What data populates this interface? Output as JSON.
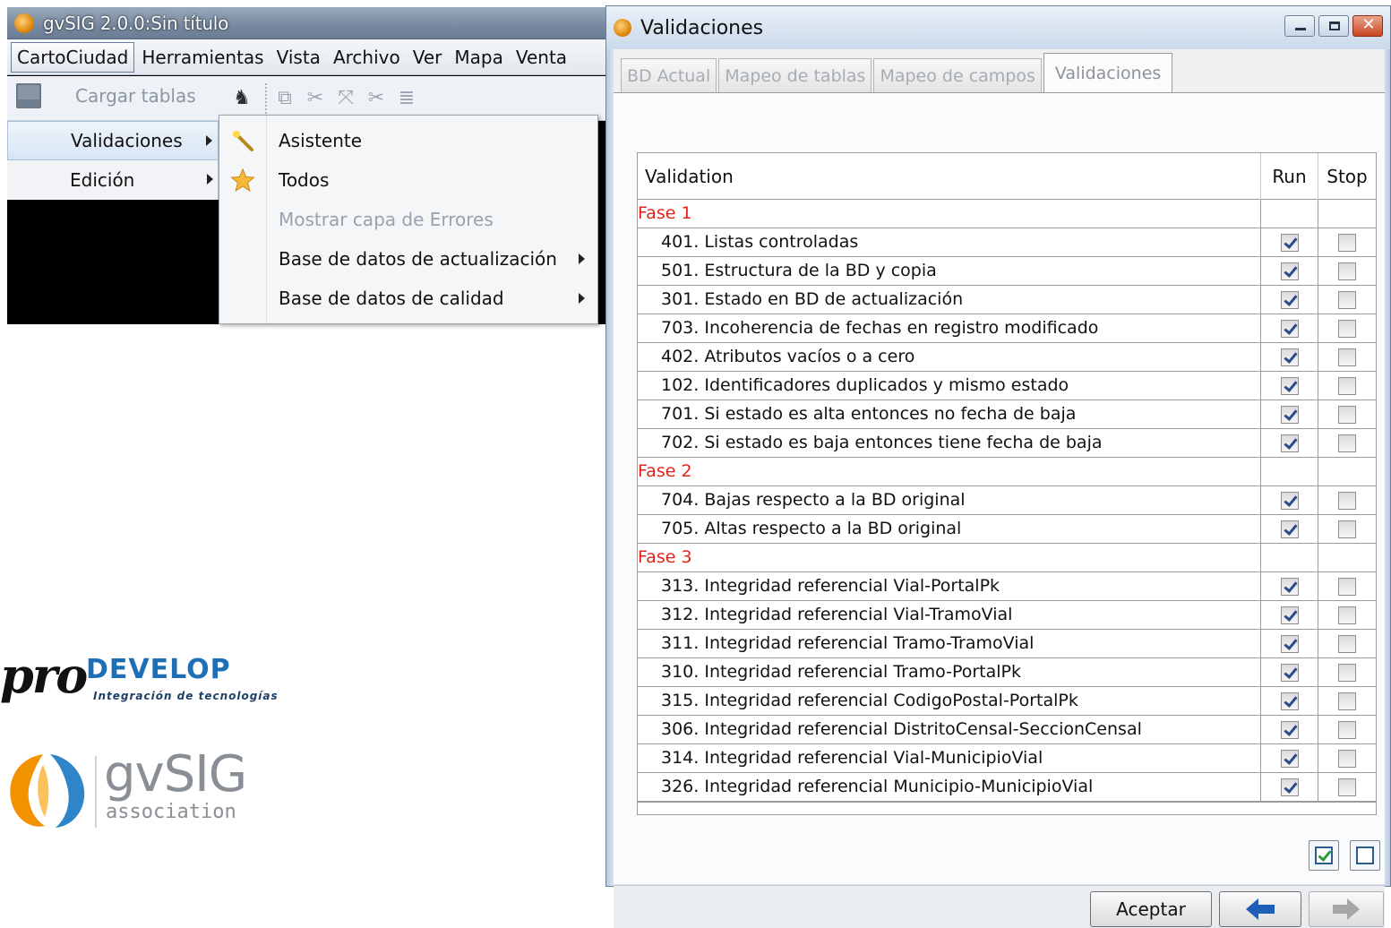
{
  "main_window": {
    "title": "gvSIG 2.0.0:Sin título",
    "menubar": [
      "CartoCiudad",
      "Herramientas",
      "Vista",
      "Archivo",
      "Ver",
      "Mapa",
      "Venta"
    ],
    "toolbar": {
      "cargar_tablas": "Cargar tablas"
    },
    "cartociudad_menu": {
      "items": [
        {
          "label": "Validaciones",
          "highlighted": true
        },
        {
          "label": "Edición",
          "highlighted": false
        }
      ]
    },
    "validaciones_submenu": {
      "items": [
        {
          "label": "Asistente",
          "icon": "wand-icon",
          "enabled": true,
          "has_submenu": false
        },
        {
          "label": "Todos",
          "icon": "star-icon",
          "enabled": true,
          "has_submenu": false
        },
        {
          "label": "Mostrar capa de Errores",
          "icon": "",
          "enabled": false,
          "has_submenu": false
        },
        {
          "label": "Base de datos de actualización",
          "icon": "",
          "enabled": true,
          "has_submenu": true
        },
        {
          "label": "Base de datos de calidad",
          "icon": "",
          "enabled": true,
          "has_submenu": true
        }
      ]
    }
  },
  "logos": {
    "prodevelop": {
      "pro": "pro",
      "develop": "DEVELOP",
      "tagline": "Integración de tecnologías"
    },
    "gvsig": {
      "name": "gvSIG",
      "sub": "association"
    }
  },
  "dialog": {
    "title": "Validaciones",
    "tabs": [
      {
        "label": "BD Actual",
        "active": false
      },
      {
        "label": "Mapeo de tablas",
        "active": false
      },
      {
        "label": "Mapeo de campos",
        "active": false
      },
      {
        "label": "Validaciones",
        "active": true
      }
    ],
    "table": {
      "headers": {
        "validation": "Validation",
        "run": "Run",
        "stop": "Stop"
      },
      "phases": [
        {
          "label": "Fase 1",
          "rows": [
            {
              "label": "401. Listas controladas",
              "run": true,
              "stop": false
            },
            {
              "label": "501. Estructura de la BD y copia",
              "run": true,
              "stop": false
            },
            {
              "label": "301. Estado en BD de actualización",
              "run": true,
              "stop": false
            },
            {
              "label": "703. Incoherencia de fechas en registro modificado",
              "run": true,
              "stop": false
            },
            {
              "label": "402. Atributos vacíos o a cero",
              "run": true,
              "stop": false
            },
            {
              "label": "102. Identificadores duplicados y mismo estado",
              "run": true,
              "stop": false
            },
            {
              "label": "701. Si estado es alta entonces no fecha de baja",
              "run": true,
              "stop": false
            },
            {
              "label": "702. Si estado es baja entonces tiene fecha de baja",
              "run": true,
              "stop": false
            }
          ]
        },
        {
          "label": "Fase 2",
          "rows": [
            {
              "label": "704. Bajas respecto a la BD original",
              "run": true,
              "stop": false
            },
            {
              "label": "705. Altas respecto a la BD original",
              "run": true,
              "stop": false
            }
          ]
        },
        {
          "label": "Fase 3",
          "rows": [
            {
              "label": "313. Integridad referencial Vial-PortalPk",
              "run": true,
              "stop": false
            },
            {
              "label": "312. Integridad referencial Vial-TramoVial",
              "run": true,
              "stop": false
            },
            {
              "label": "311. Integridad referencial Tramo-TramoVial",
              "run": true,
              "stop": false
            },
            {
              "label": "310. Integridad referencial Tramo-PortalPk",
              "run": true,
              "stop": false
            },
            {
              "label": "315. Integridad referencial CodigoPostal-PortalPk",
              "run": true,
              "stop": false
            },
            {
              "label": "306. Integridad referencial DistritoCensal-SeccionCensal",
              "run": true,
              "stop": false
            },
            {
              "label": "314. Integridad referencial Vial-MunicipioVial",
              "run": true,
              "stop": false
            },
            {
              "label": "326. Integridad referencial Municipio-MunicipioVial",
              "run": true,
              "stop": false
            }
          ]
        }
      ]
    },
    "buttons": {
      "accept": "Aceptar",
      "back_icon": "arrow-left-icon",
      "next_icon": "arrow-right-icon",
      "next_enabled": false
    },
    "colors": {
      "phase_label": "#e2231a",
      "check": "#2e4c8c"
    }
  }
}
